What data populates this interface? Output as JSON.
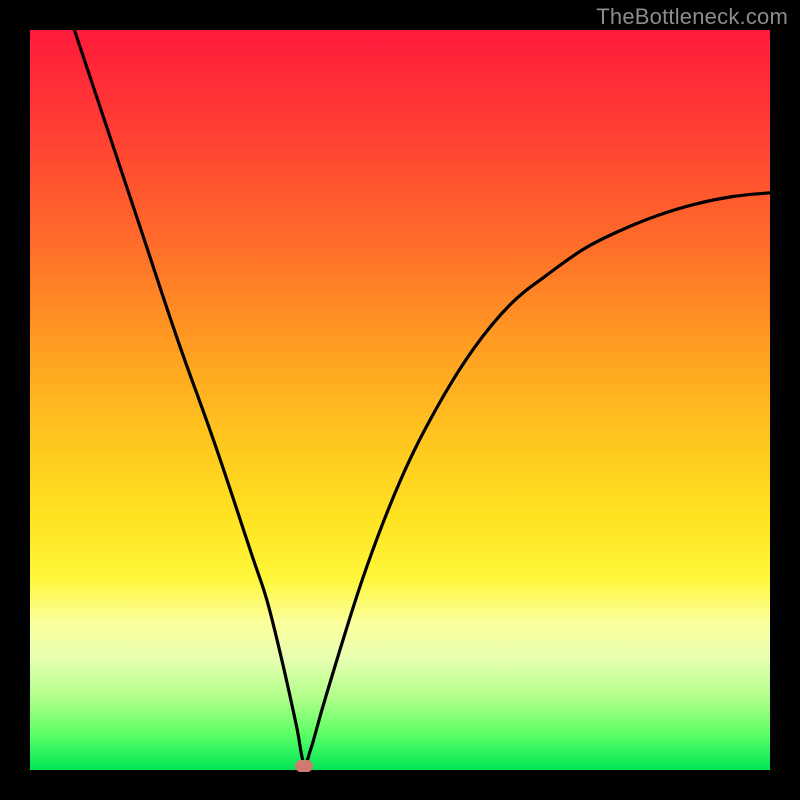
{
  "watermark": "TheBottleneck.com",
  "colors": {
    "gradient_top": "#ff1a3b",
    "gradient_bottom": "#00e756",
    "curve": "#000000",
    "marker": "#d07a72",
    "frame": "#000000"
  },
  "chart_data": {
    "type": "line",
    "title": "",
    "xlabel": "",
    "ylabel": "",
    "xlim": [
      0,
      100
    ],
    "ylim": [
      0,
      100
    ],
    "grid": false,
    "legend": false,
    "annotations": [],
    "series": [
      {
        "name": "bottleneck-curve",
        "x": [
          6,
          10,
          15,
          20,
          25,
          30,
          32,
          34,
          36,
          37,
          38,
          40,
          45,
          50,
          55,
          60,
          65,
          70,
          75,
          80,
          85,
          90,
          95,
          100
        ],
        "y": [
          100,
          88,
          73,
          58,
          44,
          29,
          23,
          15,
          6,
          1,
          3,
          10,
          26,
          39,
          49,
          57,
          63,
          67,
          70.5,
          73,
          75,
          76.5,
          77.5,
          78
        ]
      }
    ],
    "marker": {
      "x": 37,
      "y": 0.5
    }
  }
}
